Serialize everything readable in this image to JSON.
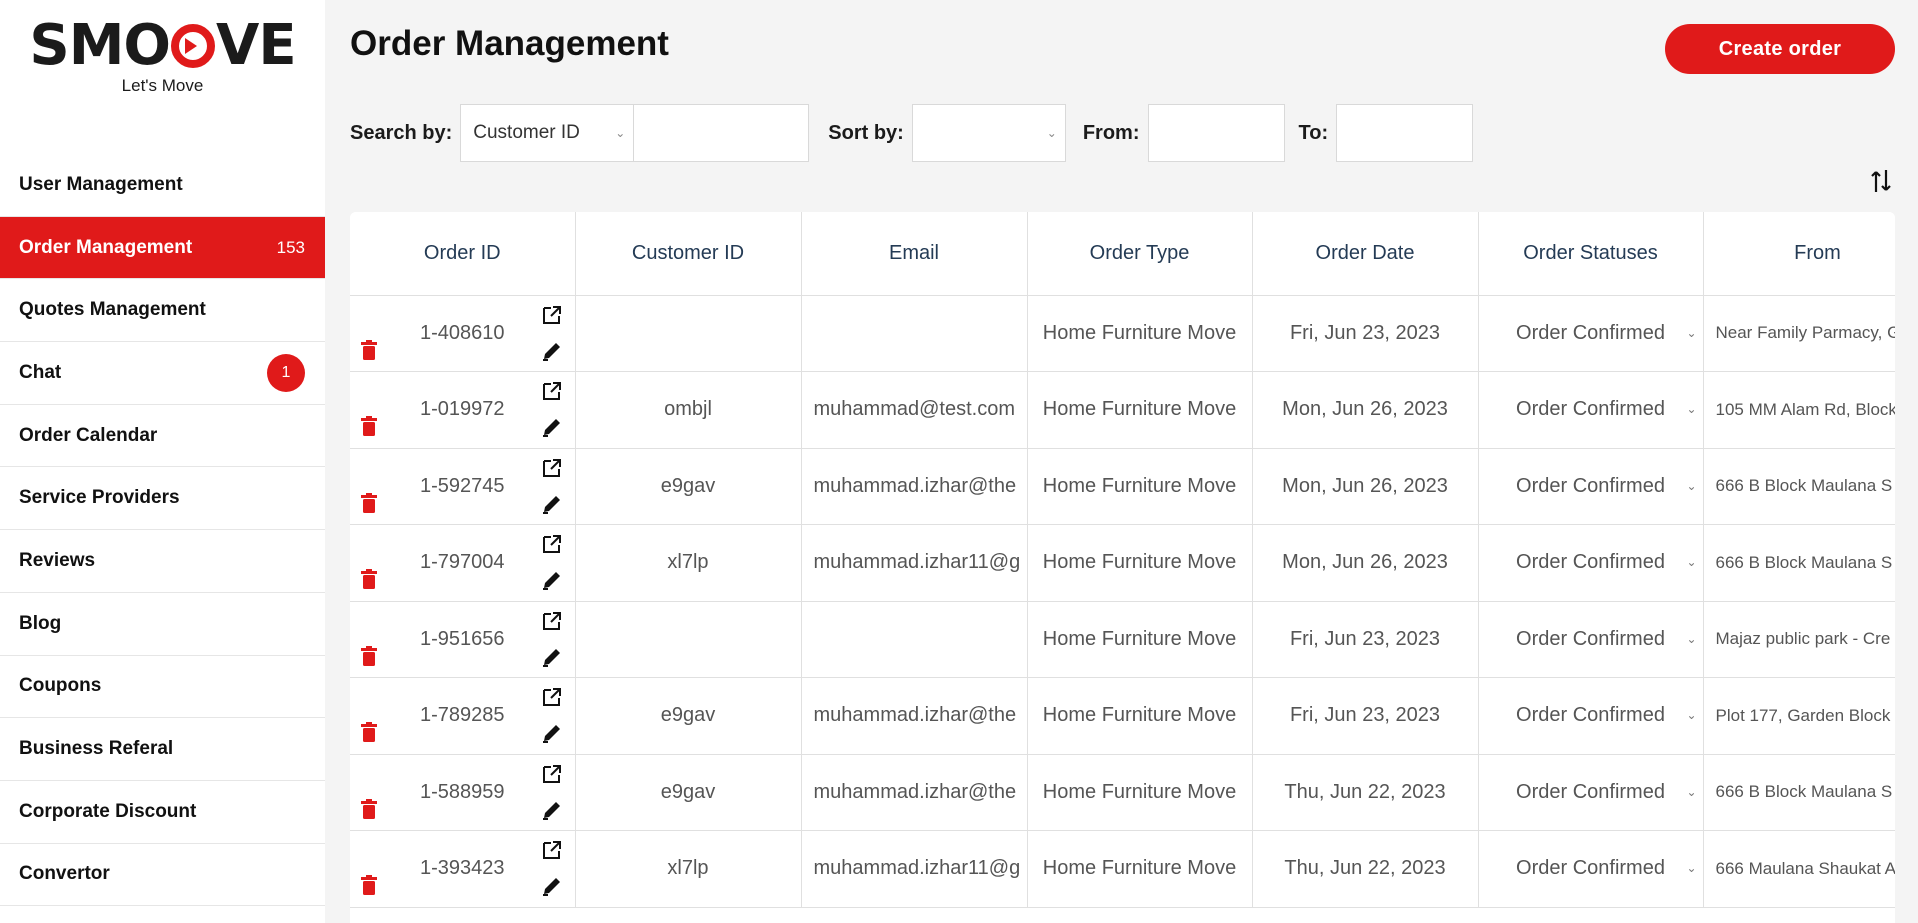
{
  "sidebar": {
    "logo_text": "SMOOVE",
    "tagline": "Let's Move",
    "items": [
      {
        "label": "User Management",
        "count": "",
        "badge": ""
      },
      {
        "label": "Order Management",
        "count": "153",
        "badge": "",
        "active": true
      },
      {
        "label": "Quotes Management",
        "count": "",
        "badge": ""
      },
      {
        "label": "Chat",
        "count": "",
        "badge": "1"
      },
      {
        "label": "Order Calendar",
        "count": "",
        "badge": ""
      },
      {
        "label": "Service Providers",
        "count": "",
        "badge": ""
      },
      {
        "label": "Reviews",
        "count": "",
        "badge": ""
      },
      {
        "label": "Blog",
        "count": "",
        "badge": ""
      },
      {
        "label": "Coupons",
        "count": "",
        "badge": ""
      },
      {
        "label": "Business Referal",
        "count": "",
        "badge": ""
      },
      {
        "label": "Corporate Discount",
        "count": "",
        "badge": ""
      },
      {
        "label": "Convertor",
        "count": "",
        "badge": ""
      }
    ]
  },
  "header": {
    "title": "Order Management",
    "create_label": "Create order"
  },
  "filters": {
    "search_label": "Search by:",
    "search_field_value": "Customer ID",
    "search_text": "",
    "sort_label": "Sort by:",
    "sort_value": "",
    "from_label": "From:",
    "from_value": "",
    "to_label": "To:",
    "to_value": ""
  },
  "table": {
    "columns": [
      "Order ID",
      "Customer ID",
      "Email",
      "Order Type",
      "Order Date",
      "Order Statuses",
      "From"
    ],
    "rows": [
      {
        "order_id": "1-408610",
        "customer_id": "",
        "email": "",
        "order_type": "Home Furniture Move",
        "order_date": "Fri, Jun 23, 2023",
        "status": "Order Confirmed",
        "from": "Near Family Parmacy, G"
      },
      {
        "order_id": "1-019972",
        "customer_id": "ombjl",
        "email": "muhammad@test.com",
        "order_type": "Home Furniture Move",
        "order_date": "Mon, Jun 26, 2023",
        "status": "Order Confirmed",
        "from": "105 MM Alam Rd, Block"
      },
      {
        "order_id": "1-592745",
        "customer_id": "e9gav",
        "email": "muhammad.izhar@the",
        "order_type": "Home Furniture Move",
        "order_date": "Mon, Jun 26, 2023",
        "status": "Order Confirmed",
        "from": "666 B Block Maulana S"
      },
      {
        "order_id": "1-797004",
        "customer_id": "xl7lp",
        "email": "muhammad.izhar11@g",
        "order_type": "Home Furniture Move",
        "order_date": "Mon, Jun 26, 2023",
        "status": "Order Confirmed",
        "from": "666 B Block Maulana S"
      },
      {
        "order_id": "1-951656",
        "customer_id": "",
        "email": "",
        "order_type": "Home Furniture Move",
        "order_date": "Fri, Jun 23, 2023",
        "status": "Order Confirmed",
        "from": "Majaz public park - Cre"
      },
      {
        "order_id": "1-789285",
        "customer_id": "e9gav",
        "email": "muhammad.izhar@the",
        "order_type": "Home Furniture Move",
        "order_date": "Fri, Jun 23, 2023",
        "status": "Order Confirmed",
        "from": "Plot 177, Garden Block"
      },
      {
        "order_id": "1-588959",
        "customer_id": "e9gav",
        "email": "muhammad.izhar@the",
        "order_type": "Home Furniture Move",
        "order_date": "Thu, Jun 22, 2023",
        "status": "Order Confirmed",
        "from": "666 B Block Maulana S"
      },
      {
        "order_id": "1-393423",
        "customer_id": "xl7lp",
        "email": "muhammad.izhar11@g",
        "order_type": "Home Furniture Move",
        "order_date": "Thu, Jun 22, 2023",
        "status": "Order Confirmed",
        "from": "666 Maulana Shaukat A"
      }
    ]
  },
  "colors": {
    "accent": "#e01a1a",
    "text": "#1b1b1b",
    "header_text": "#243b55"
  }
}
